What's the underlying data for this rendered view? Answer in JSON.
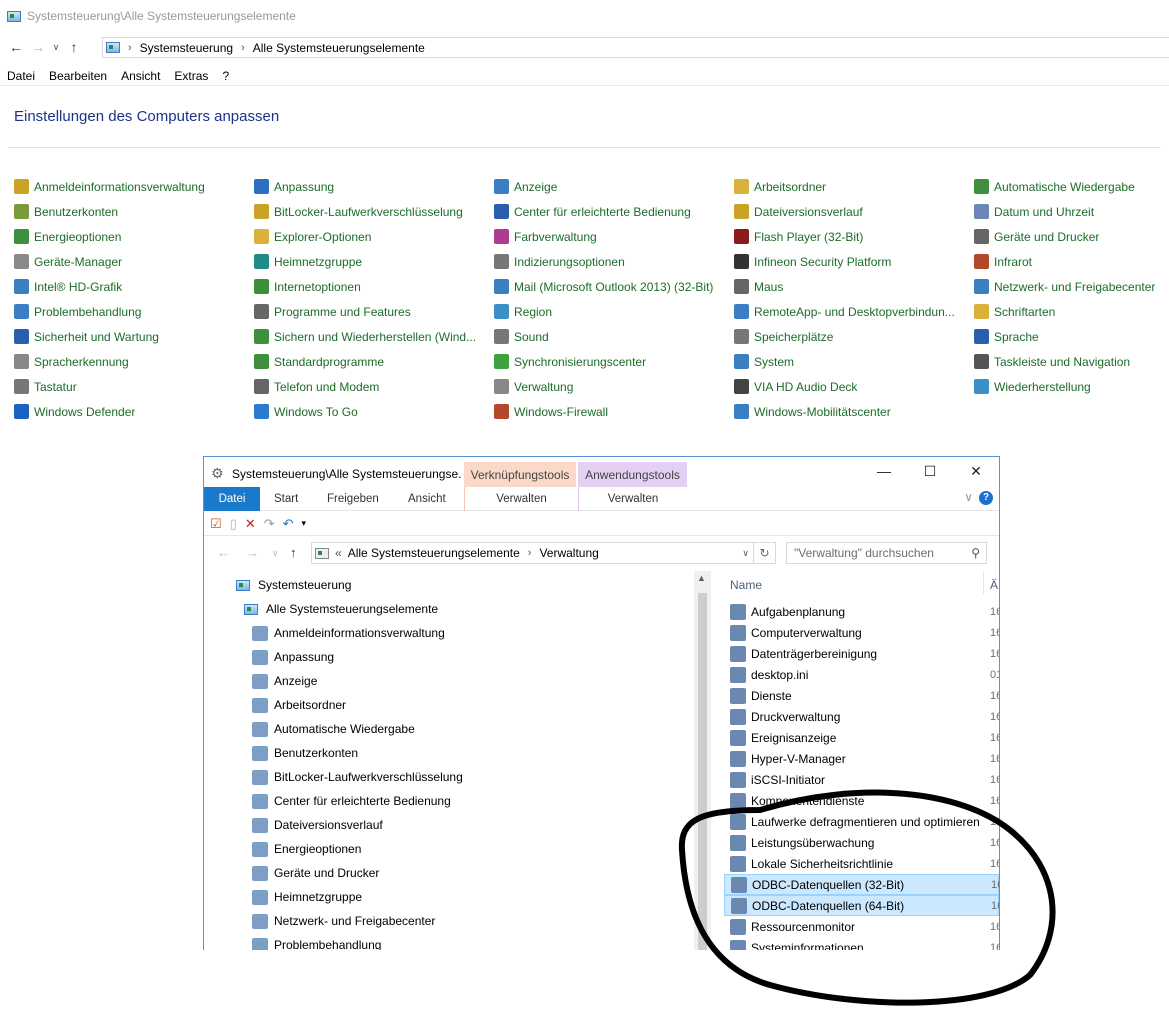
{
  "outer": {
    "title": "Systemsteuerung\\Alle Systemsteuerungselemente",
    "breadcrumb": [
      "Systemsteuerung",
      "Alle Systemsteuerungselemente"
    ],
    "menu": [
      "Datei",
      "Bearbeiten",
      "Ansicht",
      "Extras",
      "?"
    ],
    "heading": "Einstellungen des Computers anpassen",
    "columns": [
      [
        {
          "label": "Anmeldeinformationsverwaltung",
          "icon": "credential-icon",
          "color": "#c9a227"
        },
        {
          "label": "Benutzerkonten",
          "icon": "users-icon",
          "color": "#7a9b3c"
        },
        {
          "label": "Energieoptionen",
          "icon": "power-icon",
          "color": "#3e8f3e"
        },
        {
          "label": "Geräte-Manager",
          "icon": "device-manager-icon",
          "color": "#8a8a8a"
        },
        {
          "label": "Intel® HD-Grafik",
          "icon": "intel-graphics-icon",
          "color": "#3a7fc4"
        },
        {
          "label": "Problembehandlung",
          "icon": "troubleshoot-icon",
          "color": "#3a7fc4"
        },
        {
          "label": "Sicherheit und Wartung",
          "icon": "flag-icon",
          "color": "#2a5fb0"
        },
        {
          "label": "Spracherkennung",
          "icon": "microphone-icon",
          "color": "#888888"
        },
        {
          "label": "Tastatur",
          "icon": "keyboard-icon",
          "color": "#777777"
        },
        {
          "label": "Windows Defender",
          "icon": "defender-icon",
          "color": "#1a63c2"
        }
      ],
      [
        {
          "label": "Anpassung",
          "icon": "personalize-icon",
          "color": "#2e6fc2"
        },
        {
          "label": "BitLocker-Laufwerkverschlüsselung",
          "icon": "bitlocker-icon",
          "color": "#c9a227"
        },
        {
          "label": "Explorer-Optionen",
          "icon": "folder-options-icon",
          "color": "#d9b03a"
        },
        {
          "label": "Heimnetzgruppe",
          "icon": "homegroup-icon",
          "color": "#1f8b8b"
        },
        {
          "label": "Internetoptionen",
          "icon": "internet-options-icon",
          "color": "#3b8f3b"
        },
        {
          "label": "Programme und Features",
          "icon": "programs-icon",
          "color": "#666666"
        },
        {
          "label": "Sichern und Wiederherstellen (Wind...",
          "icon": "backup-icon",
          "color": "#3e8f3e"
        },
        {
          "label": "Standardprogramme",
          "icon": "default-programs-icon",
          "color": "#3e8f3e"
        },
        {
          "label": "Telefon und Modem",
          "icon": "phone-icon",
          "color": "#666666"
        },
        {
          "label": "Windows To Go",
          "icon": "windows-to-go-icon",
          "color": "#2a7ad0"
        }
      ],
      [
        {
          "label": "Anzeige",
          "icon": "display-icon",
          "color": "#3a7fc4"
        },
        {
          "label": "Center für erleichterte Bedienung",
          "icon": "ease-of-access-icon",
          "color": "#2a5fb0"
        },
        {
          "label": "Farbverwaltung",
          "icon": "color-management-icon",
          "color": "#b03a8f"
        },
        {
          "label": "Indizierungsoptionen",
          "icon": "indexing-icon",
          "color": "#777777"
        },
        {
          "label": "Mail (Microsoft Outlook 2013) (32-Bit)",
          "icon": "mail-icon",
          "color": "#3a7fc4"
        },
        {
          "label": "Region",
          "icon": "region-icon",
          "color": "#3a8fc4"
        },
        {
          "label": "Sound",
          "icon": "sound-icon",
          "color": "#777777"
        },
        {
          "label": "Synchronisierungscenter",
          "icon": "sync-icon",
          "color": "#3ea33e"
        },
        {
          "label": "Verwaltung",
          "icon": "admin-tools-icon",
          "color": "#888888"
        },
        {
          "label": "Windows-Firewall",
          "icon": "firewall-icon",
          "color": "#b5472a"
        }
      ],
      [
        {
          "label": "Arbeitsordner",
          "icon": "work-folders-icon",
          "color": "#d9b03a"
        },
        {
          "label": "Dateiversionsverlauf",
          "icon": "file-history-icon",
          "color": "#c9a227"
        },
        {
          "label": "Flash Player (32-Bit)",
          "icon": "flash-icon",
          "color": "#8b1a1a"
        },
        {
          "label": "Infineon Security Platform",
          "icon": "tpm-icon",
          "color": "#333333"
        },
        {
          "label": "Maus",
          "icon": "mouse-icon",
          "color": "#666666"
        },
        {
          "label": "RemoteApp- und Desktopverbindun...",
          "icon": "remoteapp-icon",
          "color": "#3a7fc4"
        },
        {
          "label": "Speicherplätze",
          "icon": "storage-spaces-icon",
          "color": "#777777"
        },
        {
          "label": "System",
          "icon": "system-icon",
          "color": "#3a7fc4"
        },
        {
          "label": "VIA HD Audio Deck",
          "icon": "via-audio-icon",
          "color": "#444444"
        },
        {
          "label": "Windows-Mobilitätscenter",
          "icon": "mobility-center-icon",
          "color": "#3a7fc4"
        }
      ],
      [
        {
          "label": "Automatische Wiedergabe",
          "icon": "autoplay-icon",
          "color": "#3e8f3e"
        },
        {
          "label": "Datum und Uhrzeit",
          "icon": "clock-icon",
          "color": "#6b87b5"
        },
        {
          "label": "Geräte und Drucker",
          "icon": "printer-icon",
          "color": "#666666"
        },
        {
          "label": "Infrarot",
          "icon": "infrared-icon",
          "color": "#b5472a"
        },
        {
          "label": "Netzwerk- und Freigabecenter",
          "icon": "network-icon",
          "color": "#3a7fc4"
        },
        {
          "label": "Schriftarten",
          "icon": "fonts-icon",
          "color": "#d9b03a"
        },
        {
          "label": "Sprache",
          "icon": "language-icon",
          "color": "#2a5fb0"
        },
        {
          "label": "Taskleiste und Navigation",
          "icon": "taskbar-icon",
          "color": "#555555"
        },
        {
          "label": "Wiederherstellung",
          "icon": "recovery-icon",
          "color": "#3a8fc4"
        }
      ]
    ]
  },
  "inner": {
    "title": "Systemsteuerung\\Alle Systemsteuerungse...",
    "context_tab_1": "Verknüpfungstools",
    "context_tab_2": "Anwendungstools",
    "tabs": [
      "Datei",
      "Start",
      "Freigeben",
      "Ansicht"
    ],
    "sub_tab_1": "Verwalten",
    "sub_tab_2": "Verwalten",
    "breadcrumb": [
      "Alle Systemsteuerungselemente",
      "Verwaltung"
    ],
    "breadcrumb_prefix": "«",
    "search_placeholder": "\"Verwaltung\" durchsuchen",
    "tree": [
      {
        "label": "Systemsteuerung",
        "level": 0,
        "icon": "control-panel-icon"
      },
      {
        "label": "Alle Systemsteuerungselemente",
        "level": 1,
        "icon": "control-panel-icon"
      },
      {
        "label": "Anmeldeinformationsverwaltung",
        "level": 2,
        "icon": "credential-icon"
      },
      {
        "label": "Anpassung",
        "level": 2,
        "icon": "personalize-icon"
      },
      {
        "label": "Anzeige",
        "level": 2,
        "icon": "display-icon"
      },
      {
        "label": "Arbeitsordner",
        "level": 2,
        "icon": "work-folders-icon"
      },
      {
        "label": "Automatische Wiedergabe",
        "level": 2,
        "icon": "autoplay-icon"
      },
      {
        "label": "Benutzerkonten",
        "level": 2,
        "icon": "users-icon"
      },
      {
        "label": "BitLocker-Laufwerkverschlüsselung",
        "level": 2,
        "icon": "bitlocker-icon"
      },
      {
        "label": "Center für erleichterte Bedienung",
        "level": 2,
        "icon": "ease-of-access-icon"
      },
      {
        "label": "Dateiversionsverlauf",
        "level": 2,
        "icon": "file-history-icon"
      },
      {
        "label": "Energieoptionen",
        "level": 2,
        "icon": "power-icon"
      },
      {
        "label": "Geräte und Drucker",
        "level": 2,
        "icon": "printer-icon"
      },
      {
        "label": "Heimnetzgruppe",
        "level": 2,
        "icon": "homegroup-icon"
      },
      {
        "label": "Netzwerk- und Freigabecenter",
        "level": 2,
        "icon": "network-icon"
      },
      {
        "label": "Problembehandlung",
        "level": 2,
        "icon": "troubleshoot-icon"
      }
    ],
    "file_header_name": "Name",
    "file_header_date": "Ä",
    "files": [
      {
        "name": "Aufgabenplanung",
        "date": "16",
        "selected": false,
        "icon": "task-scheduler-icon"
      },
      {
        "name": "Computerverwaltung",
        "date": "16",
        "selected": false,
        "icon": "computer-management-icon"
      },
      {
        "name": "Datenträgerbereinigung",
        "date": "16",
        "selected": false,
        "icon": "disk-cleanup-icon"
      },
      {
        "name": "desktop.ini",
        "date": "01",
        "selected": false,
        "icon": "ini-file-icon"
      },
      {
        "name": "Dienste",
        "date": "16",
        "selected": false,
        "icon": "services-icon"
      },
      {
        "name": "Druckverwaltung",
        "date": "16",
        "selected": false,
        "icon": "print-management-icon"
      },
      {
        "name": "Ereignisanzeige",
        "date": "16",
        "selected": false,
        "icon": "event-viewer-icon"
      },
      {
        "name": "Hyper-V-Manager",
        "date": "16",
        "selected": false,
        "icon": "hyperv-icon"
      },
      {
        "name": "iSCSI-Initiator",
        "date": "16",
        "selected": false,
        "icon": "iscsi-icon"
      },
      {
        "name": "Komponentendienste",
        "date": "16",
        "selected": false,
        "icon": "component-services-icon"
      },
      {
        "name": "Laufwerke defragmentieren und optimieren",
        "date": "16",
        "selected": false,
        "icon": "defrag-icon"
      },
      {
        "name": "Leistungsüberwachung",
        "date": "16",
        "selected": false,
        "icon": "perfmon-icon"
      },
      {
        "name": "Lokale Sicherheitsrichtlinie",
        "date": "16",
        "selected": false,
        "icon": "security-policy-icon"
      },
      {
        "name": "ODBC-Datenquellen (32-Bit)",
        "date": "16",
        "selected": true,
        "icon": "odbc-icon"
      },
      {
        "name": "ODBC-Datenquellen (64-Bit)",
        "date": "16",
        "selected": true,
        "icon": "odbc-icon"
      },
      {
        "name": "Ressourcenmonitor",
        "date": "16",
        "selected": false,
        "icon": "resource-monitor-icon"
      },
      {
        "name": "Systeminformationen",
        "date": "16",
        "selected": false,
        "icon": "system-info-icon"
      }
    ]
  }
}
